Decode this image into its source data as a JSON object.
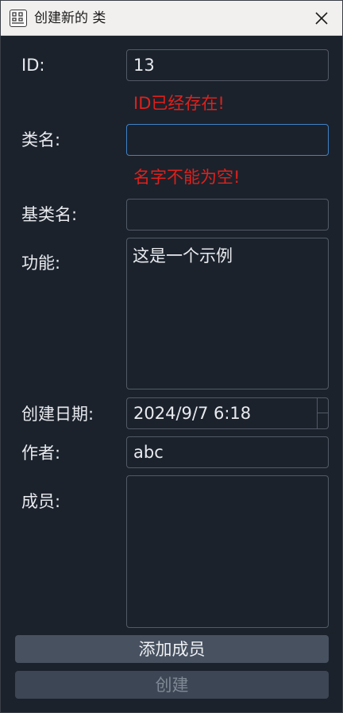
{
  "window": {
    "title": "创建新的 类"
  },
  "form": {
    "id_label": "ID:",
    "id_value": "13",
    "id_error": "ID已经存在!",
    "class_name_label": "类名:",
    "class_name_value": "",
    "class_name_error": "名字不能为空!",
    "base_class_label": "基类名:",
    "base_class_value": "",
    "function_label": "功能:",
    "function_value": "这是一个示例",
    "created_date_label": "创建日期:",
    "created_date_value": "2024/9/7 6:18",
    "author_label": "作者:",
    "author_value": "abc",
    "members_label": "成员:",
    "members_value": ""
  },
  "buttons": {
    "add_member": "添加成员",
    "create": "创建"
  },
  "colors": {
    "window_bg": "#1b222c",
    "error": "#e0201b",
    "focus_border": "#3f82c6",
    "button_bg": "#475160"
  },
  "icons": {
    "app": "class-grid-icon",
    "close": "close-icon"
  }
}
